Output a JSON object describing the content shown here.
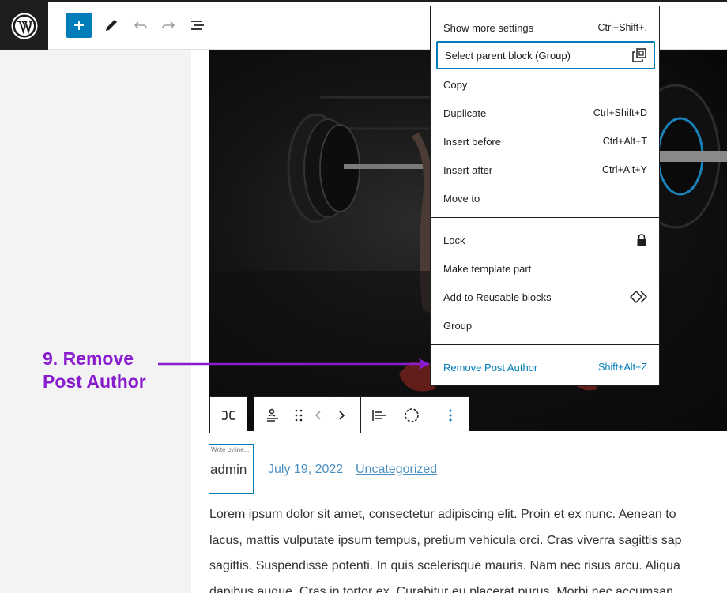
{
  "topbar": {
    "icons": [
      "wordpress-logo",
      "plus-icon",
      "pencil-icon",
      "undo-icon",
      "redo-icon",
      "list-view-icon"
    ]
  },
  "block_toolbar": {
    "icons": [
      "transform-icon",
      "author-icon",
      "drag-handle-icon",
      "chevron-left-icon",
      "chevron-right-icon",
      "align-left-icon",
      "circle-dashed-icon",
      "more-vertical-icon"
    ]
  },
  "post": {
    "byline_placeholder": "Write byline...",
    "author": "admin",
    "date": "July 19, 2022",
    "category": "Uncategorized",
    "paragraph_lines": [
      "Lorem ipsum dolor sit amet, consectetur adipiscing elit. Proin et ex nunc. Aenean to",
      "lacus, mattis vulputate ipsum tempus, pretium vehicula orci. Cras viverra sagittis sap",
      "sagittis. Suspendisse potenti. In quis scelerisque mauris. Nam nec risus arcu. Aliqua",
      "dapibus augue. Cras in tortor ex. Curabitur eu placerat purus. Morbi nec accumsan"
    ]
  },
  "annotation": {
    "line1": "9. Remove",
    "line2": "Post Author"
  },
  "menu": {
    "items": [
      {
        "label": "Show more settings",
        "shortcut": "Ctrl+Shift+,"
      },
      {
        "label": "Select parent block (Group)",
        "shortcut": ""
      },
      {
        "label": "Copy",
        "shortcut": ""
      },
      {
        "label": "Duplicate",
        "shortcut": "Ctrl+Shift+D"
      },
      {
        "label": "Insert before",
        "shortcut": "Ctrl+Alt+T"
      },
      {
        "label": "Insert after",
        "shortcut": "Ctrl+Alt+Y"
      },
      {
        "label": "Move to",
        "shortcut": ""
      },
      {
        "label": "Lock",
        "shortcut": ""
      },
      {
        "label": "Make template part",
        "shortcut": ""
      },
      {
        "label": "Add to Reusable blocks",
        "shortcut": ""
      },
      {
        "label": "Group",
        "shortcut": ""
      },
      {
        "label": "Remove Post Author",
        "shortcut": "Shift+Alt+Z"
      }
    ]
  },
  "colors": {
    "accent": "#007cba",
    "annotation": "#8a1ccf",
    "dark": "#1e1e1e"
  }
}
